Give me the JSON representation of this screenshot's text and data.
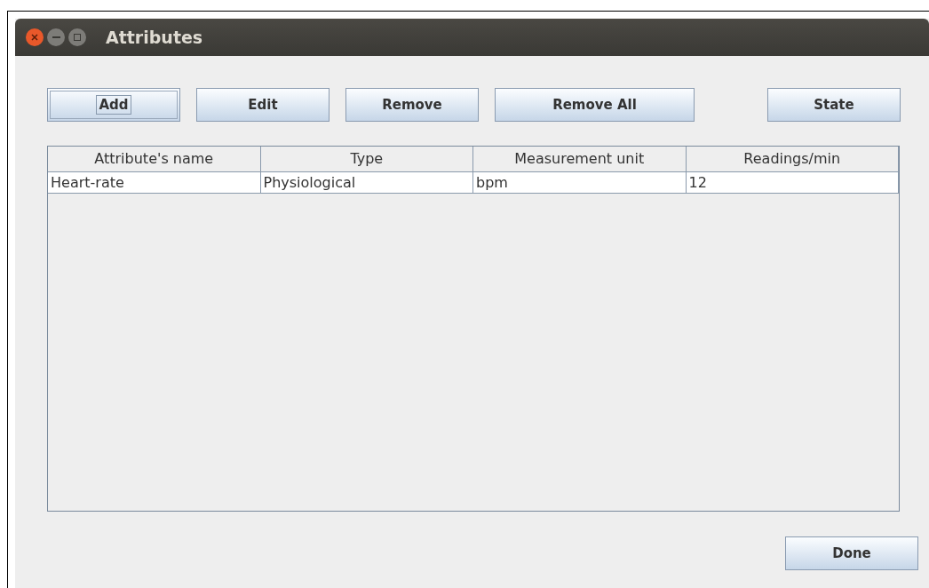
{
  "window": {
    "title": "Attributes"
  },
  "toolbar": [
    {
      "label": "Add",
      "focused": true
    },
    {
      "label": "Edit",
      "focused": false
    },
    {
      "label": "Remove",
      "focused": false
    },
    {
      "label": "Remove All",
      "focused": false
    },
    {
      "label": "State",
      "focused": false
    }
  ],
  "table": {
    "columns": [
      "Attribute's name",
      "Type",
      "Measurement unit",
      "Readings/min"
    ],
    "rows": [
      [
        "Heart-rate",
        "Physiological",
        "bpm",
        "12"
      ]
    ]
  },
  "footer": {
    "button": "Done"
  }
}
